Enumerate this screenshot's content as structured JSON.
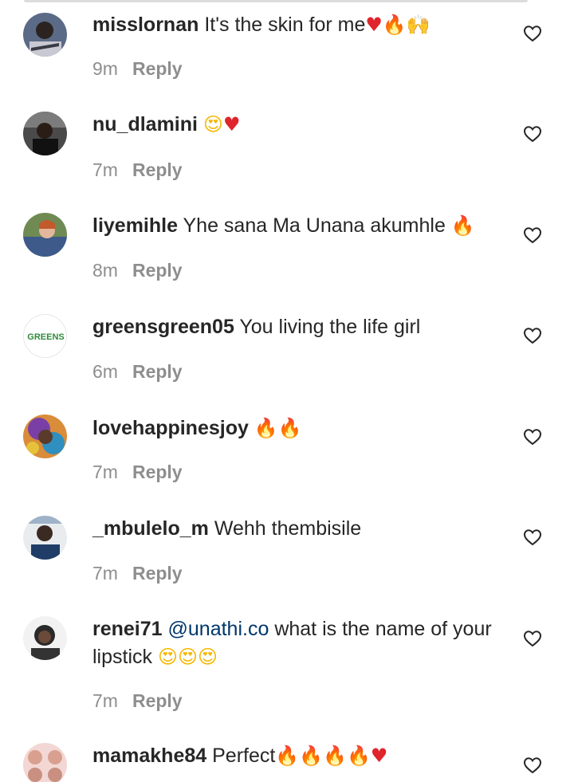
{
  "comments": [
    {
      "username": "misslornan",
      "text": "It's the skin for me",
      "emoji": [
        "♥",
        "🔥",
        "🙌"
      ],
      "time": "9m",
      "reply": "Reply"
    },
    {
      "username": "nu_dlamini",
      "text": "",
      "emoji": [
        "😍",
        "♥"
      ],
      "time": "7m",
      "reply": "Reply"
    },
    {
      "username": "liyemihle",
      "text": "Yhe sana Ma Unana akumhle",
      "emoji": [
        "🔥"
      ],
      "time": "8m",
      "reply": "Reply"
    },
    {
      "username": "greensgreen05",
      "text": "You living the life girl",
      "emoji": [],
      "time": "6m",
      "reply": "Reply",
      "avatar_label": "GREENS"
    },
    {
      "username": "lovehappinesjoy",
      "text": "",
      "emoji": [
        "🔥",
        "🔥"
      ],
      "time": "7m",
      "reply": "Reply"
    },
    {
      "username": "_mbulelo_m",
      "text": "Wehh thembisile",
      "emoji": [],
      "time": "7m",
      "reply": "Reply"
    },
    {
      "username": "renei71",
      "mention": "@unathi.co",
      "text": "what is the name of your lipstick",
      "emoji": [
        "😍",
        "😍",
        "😍"
      ],
      "time": "7m",
      "reply": "Reply"
    },
    {
      "username": "mamakhe84",
      "text": "Perfect",
      "emoji": [
        "🔥",
        "🔥",
        "🔥",
        "🔥",
        "♥"
      ],
      "time": "",
      "reply": ""
    }
  ],
  "colors": {
    "text": "#262626",
    "meta": "#8e8e8e",
    "mention": "#00376b",
    "heart_outline": "#262626"
  }
}
